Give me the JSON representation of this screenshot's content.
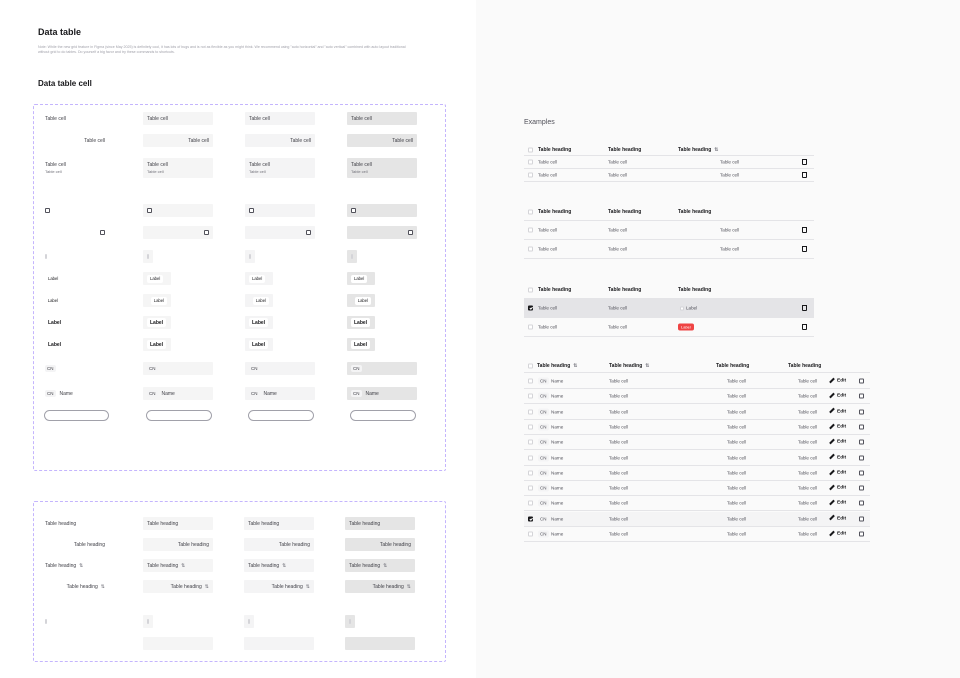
{
  "page": {
    "title": "Data table",
    "note": "Note: While the new grid feature in Figma (since May 2025) is definitely cool, it has lots of bugs and is not as flexible as you might think. We recommend using \"auto horizontal\" and \"auto vertical\" combined with auto layout traditional without grid to do tables. Do yourself a big favor and try these commands to shortcuts.",
    "cell_section_title": "Data table cell",
    "examples_title": "Examples"
  },
  "labels": {
    "cell": "Table cell",
    "heading": "Table heading",
    "label": "Label",
    "cn": "CN",
    "name": "Name",
    "edit": "Edit",
    "sort_icon": "⇅"
  }
}
